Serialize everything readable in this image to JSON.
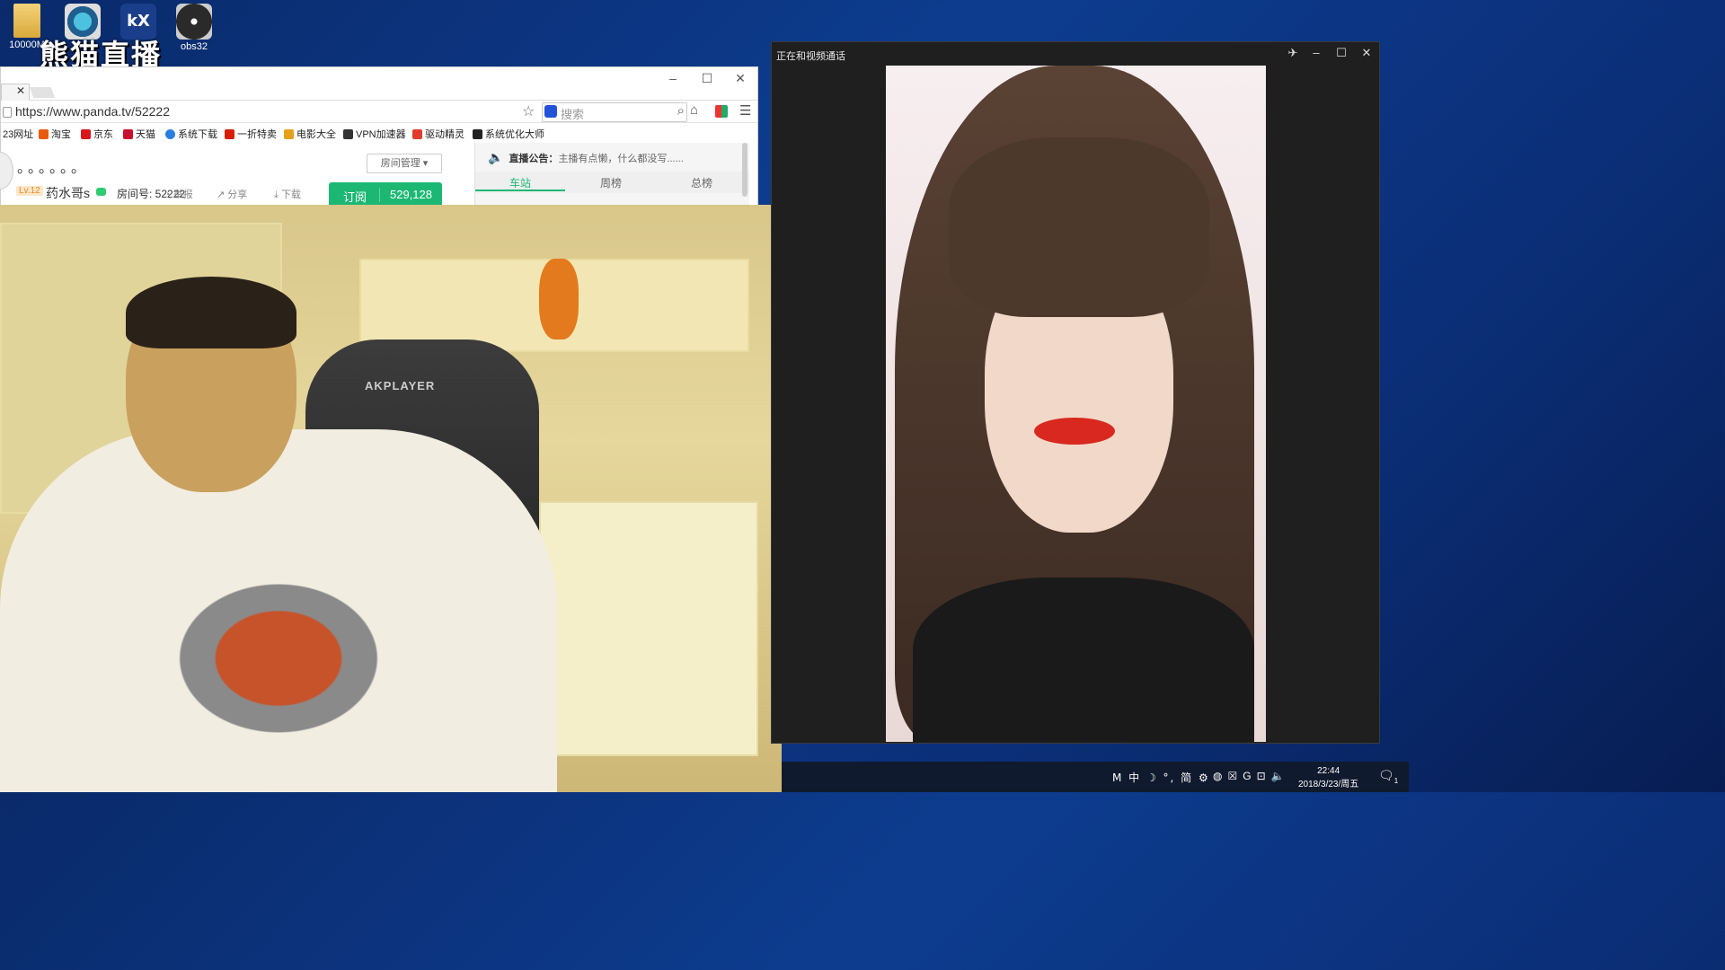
{
  "desktop": {
    "icons": [
      {
        "label": "10000M",
        "icon": "folder-icon"
      },
      {
        "label": "",
        "icon": "gear-app-icon"
      },
      {
        "label": "",
        "icon": "kx-app-icon"
      },
      {
        "label": "obs32",
        "icon": "obs-icon"
      }
    ],
    "watermark": "熊猫直播"
  },
  "browser": {
    "url": "https://www.panda.tv/52222",
    "search_placeholder": "搜索",
    "bookmarks": [
      "23网址",
      "淘宝",
      "京东",
      "天猫",
      "系统下载",
      "一折特卖",
      "电影大全",
      "VPN加速器",
      "驱动精灵",
      "系统优化大师"
    ],
    "bookmark_colors": [
      "#f0a000",
      "#e85b0e",
      "#d8161c",
      "#c8102e",
      "#2a7de1",
      "#d81e06",
      "#e3a11c",
      "#333333",
      "#e13d2c",
      "#222222"
    ]
  },
  "room": {
    "title_dots": "。。。。。。",
    "level": "Lv.12",
    "host_name": "药水哥s",
    "room_number": "房间号: 52222",
    "report": "举报",
    "share": "分享",
    "download": "下载",
    "room_manage": "房间管理",
    "subscribe_label": "订阅",
    "subscribe_count": "529,128"
  },
  "panel": {
    "notice_label": "直播公告：",
    "notice_text": "主播有点懒，什么都没写......",
    "tabs": [
      "车站",
      "周榜",
      "总榜"
    ],
    "active_tab": 0
  },
  "webcam": {
    "chair_brand": "AKPLAYER"
  },
  "call_window": {
    "title": "正在和视频通话"
  },
  "taskbar": {
    "tray": "M 中 ☽ °, 简 ⚙",
    "time": "22:44",
    "date": "2018/3/23/周五",
    "notification_count": "1"
  },
  "colors": {
    "accent": "#1cb873",
    "desktop_bg": "#0d3c8f"
  }
}
